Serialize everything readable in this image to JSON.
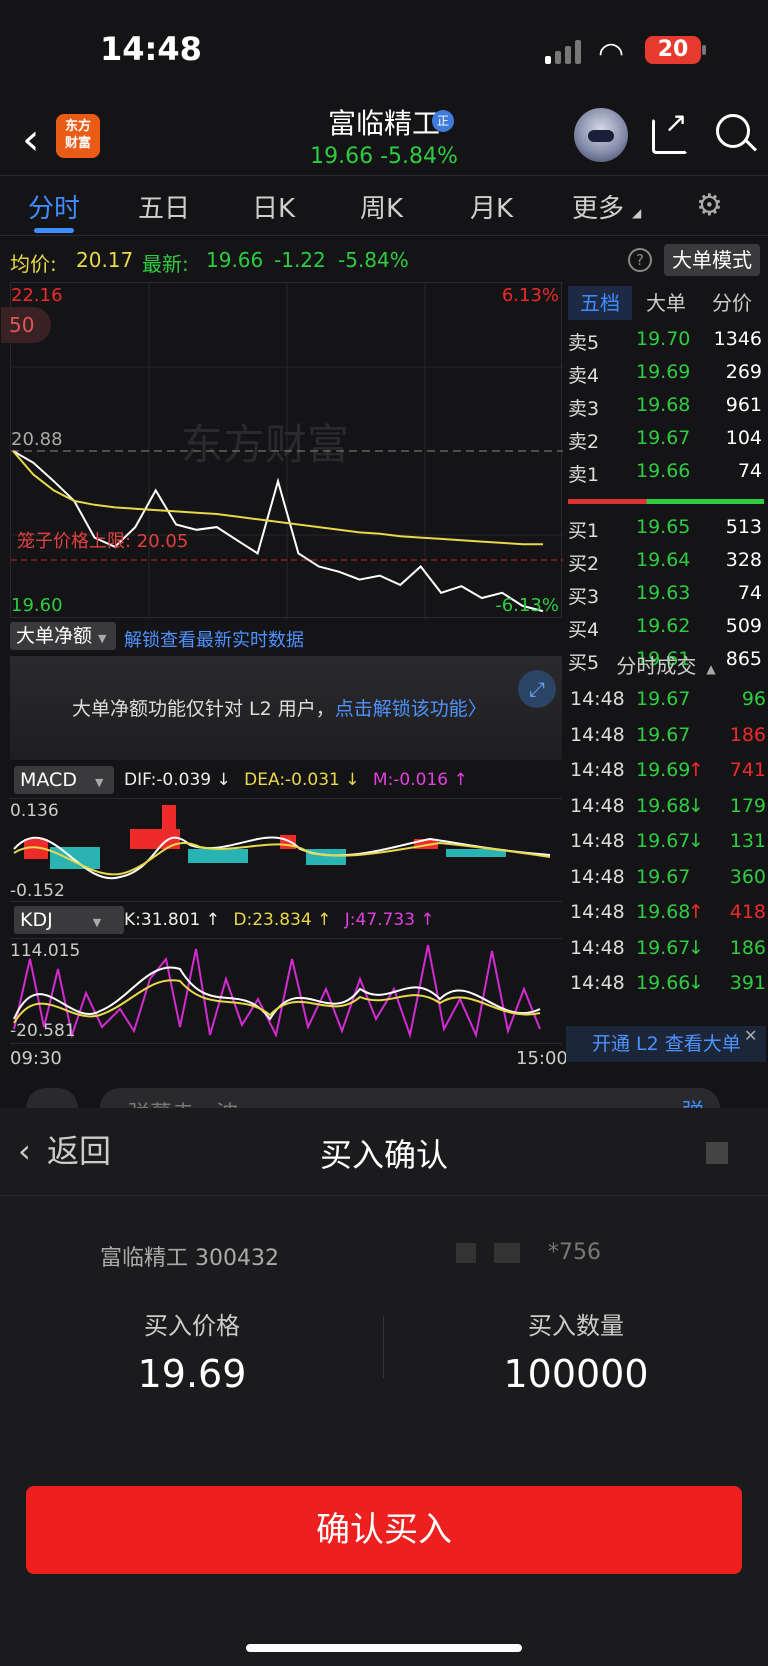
{
  "status": {
    "time": "14:48",
    "battery": "20"
  },
  "nav": {
    "logo_line1": "东方",
    "logo_line2": "财富",
    "stock_name": "富临精工",
    "badge": "正",
    "price_line": "19.66  -5.84%"
  },
  "tabs": [
    {
      "label": "分时"
    },
    {
      "label": "五日"
    },
    {
      "label": "日K"
    },
    {
      "label": "周K"
    },
    {
      "label": "月K"
    },
    {
      "label": "更多"
    }
  ],
  "summary": {
    "avg_label": "均价:",
    "avg_value": "20.17",
    "latest_label": "最新:",
    "latest_value": "19.66",
    "change": "-1.22",
    "change_pct": "-5.84%",
    "help": "?",
    "mode_button": "大单模式"
  },
  "chart": {
    "top_price": "22.16",
    "top_pct": "6.13%",
    "bottom_price": "19.60",
    "bottom_pct": "-6.13%",
    "ref_price": "20.88",
    "limit_label": "笼子价格上限: 20.05",
    "badge_left": "50",
    "watermark": "东方财富",
    "time_start": "09:30",
    "time_end": "15:00"
  },
  "chart_data": [
    {
      "type": "line",
      "title": "",
      "xlabel": "",
      "ylabel": "",
      "x": [
        "09:30",
        "15:00"
      ],
      "ylim": [
        19.6,
        22.16
      ],
      "series": [
        {
          "name": "",
          "values": [
            20.88,
            20.79,
            20.65,
            20.5,
            20.22,
            20.15,
            20.3,
            20.58,
            20.32,
            20.28,
            20.3,
            20.2,
            20.1,
            20.65,
            20.1,
            20.0,
            19.96,
            19.9,
            19.93,
            19.86,
            20.0,
            19.8,
            19.85,
            19.76,
            19.8,
            19.7,
            19.66
          ]
        },
        {
          "name": "",
          "values": [
            20.88,
            20.7,
            20.58,
            20.5,
            20.47,
            20.45,
            20.44,
            20.43,
            20.42,
            20.41,
            20.4,
            20.38,
            20.36,
            20.34,
            20.32,
            20.3,
            20.28,
            20.26,
            20.25,
            20.23,
            20.22,
            20.21,
            20.2,
            20.19,
            20.18,
            20.17,
            20.17
          ]
        }
      ]
    }
  ],
  "big_order": {
    "select": "大单净额",
    "link": "解锁查看最新实时数据",
    "panel_text": "大单净额功能仅针对 L2 用户，",
    "panel_link": "点击解锁该功能",
    "panel_link_arrow": "〉"
  },
  "macd": {
    "select": "MACD",
    "dif": "DIF:-0.039 ↓",
    "dea": "DEA:-0.031 ↓",
    "m": "M:-0.016 ↑",
    "top": "0.136",
    "bottom": "-0.152"
  },
  "kdj": {
    "select": "KDJ",
    "k": "K:31.801 ↑",
    "d": "D:23.834 ↑",
    "j": "J:47.733 ↑",
    "top": "114.015",
    "bottom": "-20.581"
  },
  "orderbook": {
    "tabs": [
      "五档",
      "大单",
      "分价"
    ],
    "asks": [
      {
        "label": "卖5",
        "price": "19.70",
        "vol": "1346"
      },
      {
        "label": "卖4",
        "price": "19.69",
        "vol": "269"
      },
      {
        "label": "卖3",
        "price": "19.68",
        "vol": "961"
      },
      {
        "label": "卖2",
        "price": "19.67",
        "vol": "104"
      },
      {
        "label": "卖1",
        "price": "19.66",
        "vol": "74"
      }
    ],
    "bids": [
      {
        "label": "买1",
        "price": "19.65",
        "vol": "513"
      },
      {
        "label": "买2",
        "price": "19.64",
        "vol": "328"
      },
      {
        "label": "买3",
        "price": "19.63",
        "vol": "74"
      },
      {
        "label": "买4",
        "price": "19.62",
        "vol": "509"
      },
      {
        "label": "买5",
        "price": "19.61",
        "vol": "865"
      }
    ],
    "trades_title": "分时成交",
    "trades": [
      {
        "time": "14:48",
        "price": "19.67",
        "arrow": "",
        "vol": "96",
        "side": "buy"
      },
      {
        "time": "14:48",
        "price": "19.67",
        "arrow": "",
        "vol": "186",
        "side": "sell"
      },
      {
        "time": "14:48",
        "price": "19.69",
        "arrow": "↑",
        "vol": "741",
        "side": "sell"
      },
      {
        "time": "14:48",
        "price": "19.68",
        "arrow": "↓",
        "vol": "179",
        "side": "buy"
      },
      {
        "time": "14:48",
        "price": "19.67",
        "arrow": "↓",
        "vol": "131",
        "side": "buy"
      },
      {
        "time": "14:48",
        "price": "19.67",
        "arrow": "",
        "vol": "360",
        "side": "buy"
      },
      {
        "time": "14:48",
        "price": "19.68",
        "arrow": "↑",
        "vol": "418",
        "side": "sell"
      },
      {
        "time": "14:48",
        "price": "19.67",
        "arrow": "↓",
        "vol": "186",
        "side": "buy"
      },
      {
        "time": "14:48",
        "price": "19.66",
        "arrow": "↓",
        "vol": "391",
        "side": "buy"
      }
    ],
    "l2_banner": "开通 L2 查看大单",
    "close": "✕"
  },
  "danmaku": {
    "placeholder": "弹幕走一波...",
    "button": "弹"
  },
  "sheet": {
    "back": "返回",
    "title": "买入确认",
    "stock_info": "富临精工 300432",
    "account_masked": "*756",
    "price_label": "买入价格",
    "price_value": "19.69",
    "qty_label": "买入数量",
    "qty_value": "100000",
    "confirm_button": "确认买入"
  },
  "colors": {
    "up": "#ee2b2b",
    "down": "#2ecc40",
    "accent": "#3f8cff",
    "avg_line": "#e8d84a",
    "confirm": "#ee1f1f"
  }
}
